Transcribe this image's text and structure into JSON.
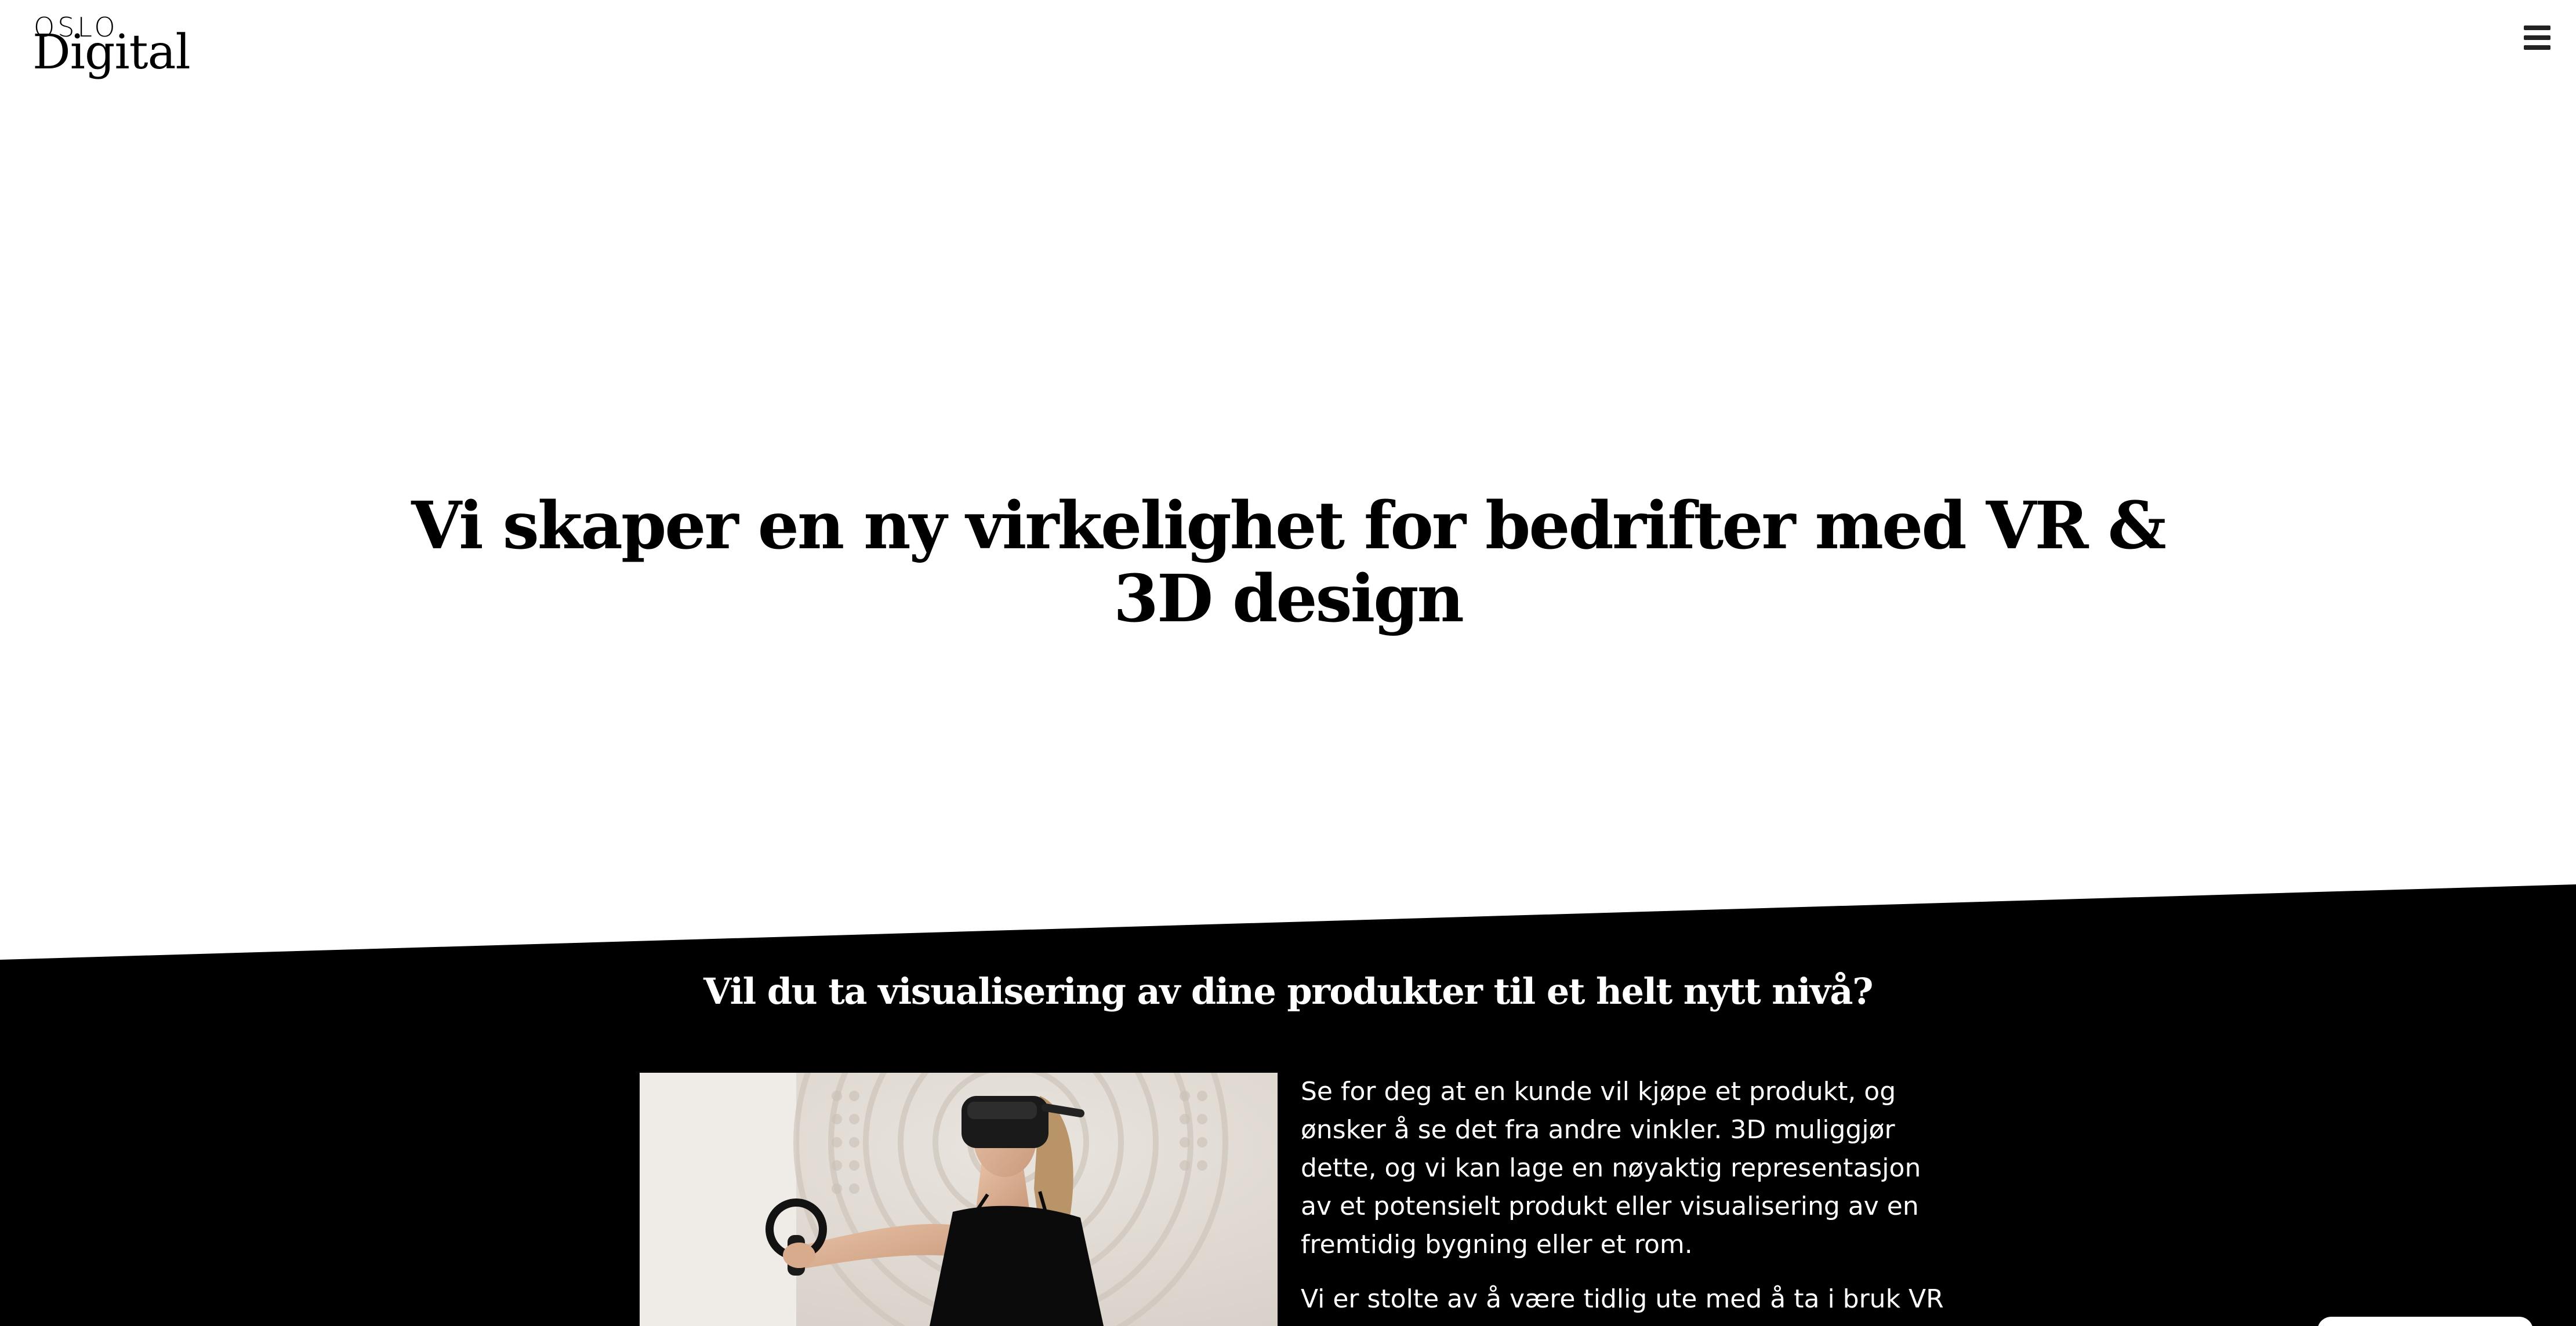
{
  "header": {
    "logo_top": "OSLO",
    "logo_bottom": "Digital",
    "menu_icon": "hamburger-menu-icon"
  },
  "hero": {
    "title": "Vi skaper en ny virkelighet for bedrifter med VR & 3D design"
  },
  "section": {
    "title": "Vil du ta visualisering av dine produkter til et helt nytt nivå?",
    "paragraph_1": "Se for deg at en kunde vil kjøpe et produkt, og ønsker å se det fra andre vinkler. 3D muliggjør dette, og vi kan lage en nøyaktig representasjon av et potensielt produkt eller visualisering av en fremtidig bygning eller et rom.",
    "paragraph_2": "Vi er stolte av å være tidlig ute med å ta i bruk VR i"
  },
  "colors": {
    "background": "#ffffff",
    "dark_section": "#000000",
    "text_dark": "#000000",
    "text_light": "#ffffff"
  }
}
